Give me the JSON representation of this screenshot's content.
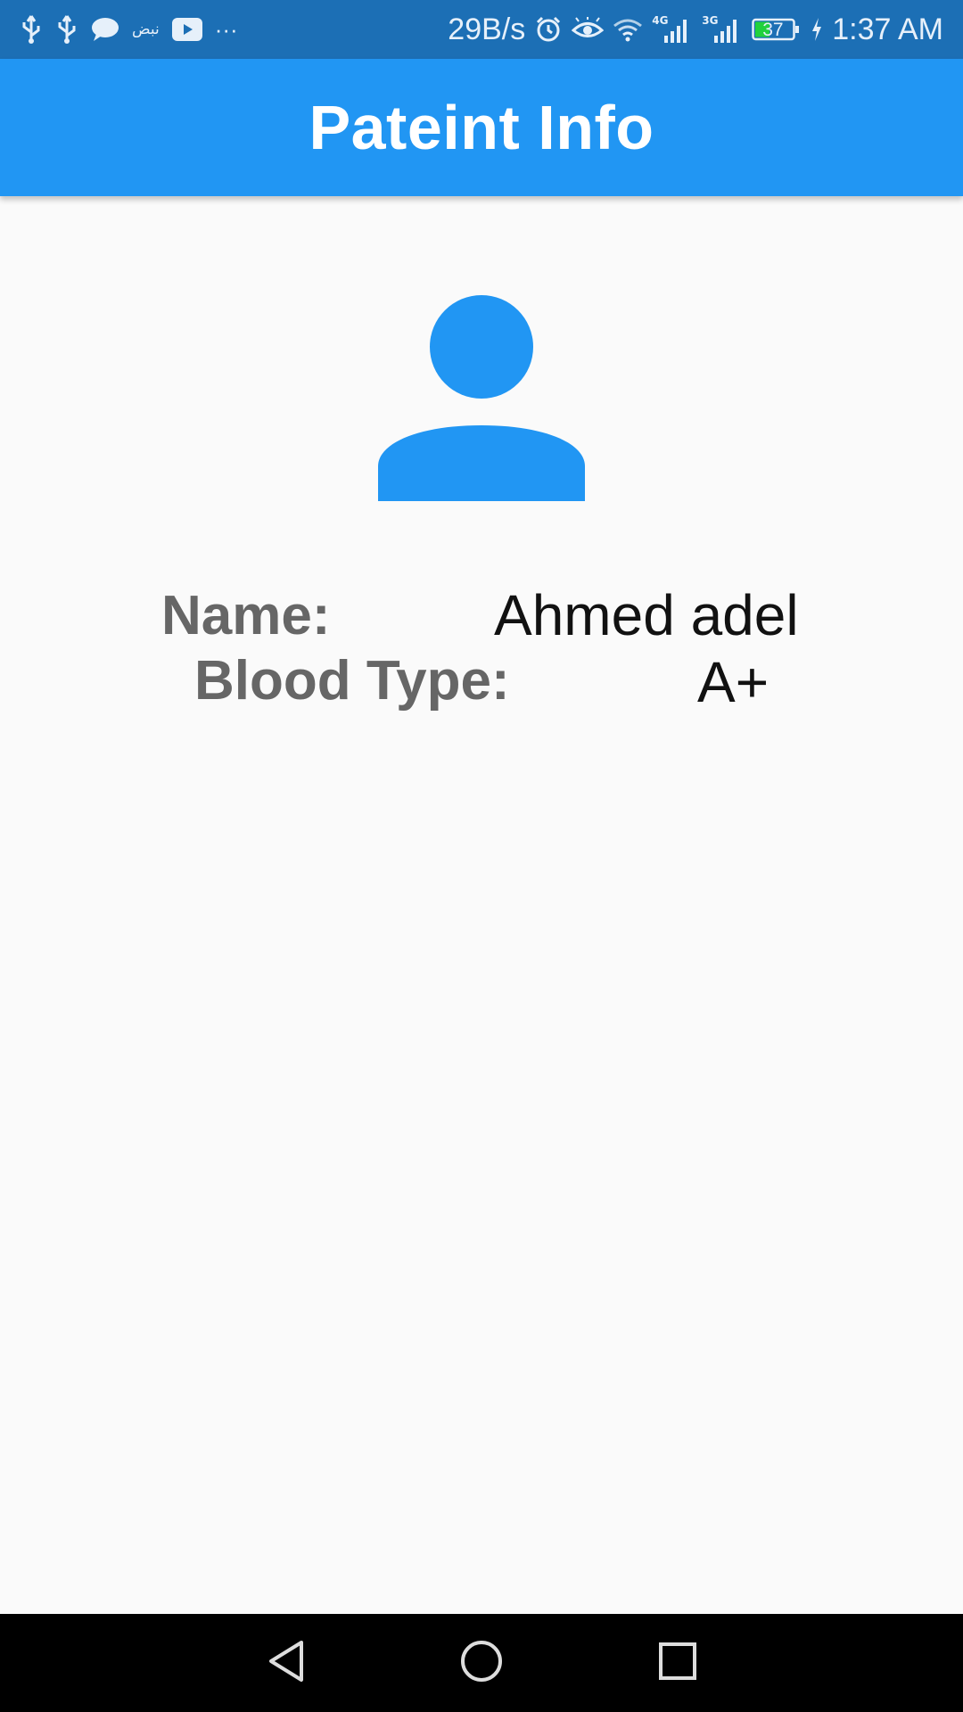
{
  "status_bar": {
    "left_text": "نبض",
    "overflow": "···",
    "speed": "29B/s",
    "net_4g": "4G",
    "net_3g": "3G",
    "battery": "37",
    "time": "1:37 AM",
    "icons": [
      "usb-icon",
      "usb-icon",
      "chat-bubble-icon",
      "youtube-icon",
      "more-icon",
      "alarm-icon",
      "eye-icon",
      "wifi-icon",
      "signal-icon",
      "signal-icon",
      "battery-icon",
      "charging-icon"
    ]
  },
  "app_bar": {
    "title": "Pateint Info",
    "color": "#2196F3"
  },
  "patient": {
    "avatar_icon": "person-icon",
    "name_label": "Name:",
    "name_value": "Ahmed adel",
    "blood_label": "Blood Type:",
    "blood_value": "A+"
  },
  "nav_bar": {
    "buttons": [
      "back-icon",
      "home-icon",
      "recents-icon"
    ]
  }
}
